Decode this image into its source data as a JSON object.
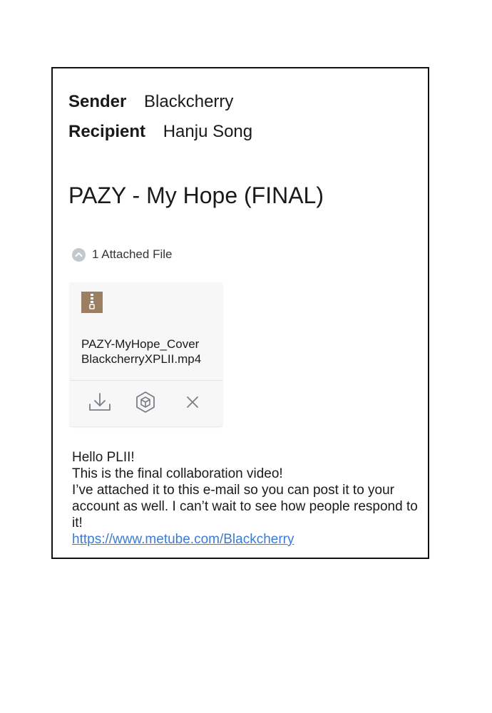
{
  "email": {
    "sender_label": "Sender",
    "sender_value": "Blackcherry",
    "recipient_label": "Recipient",
    "recipient_value": "Hanju Song",
    "subject": "PAZY - My Hope (FINAL)"
  },
  "attachments": {
    "count_label": "1 Attached File",
    "files": [
      {
        "name_line1": "PAZY-MyHope_Cover",
        "name_line2": "BlackcherryXPLII.mp4",
        "icon": "zip-file-icon"
      }
    ],
    "actions": [
      {
        "name": "download",
        "icon": "download-icon"
      },
      {
        "name": "archive",
        "icon": "cube-icon"
      },
      {
        "name": "remove",
        "icon": "close-icon"
      }
    ]
  },
  "body": {
    "lines": [
      "Hello PLII!",
      "This is the final collaboration video!",
      "I’ve attached it to this e-mail so you can post it to your account as well. I can’t wait to see how people respond to it!"
    ],
    "link": "https://www.metube.com/Blackcherry"
  },
  "colors": {
    "link": "#3b7bd4",
    "zip_icon": "#9a7f62",
    "icon_gray": "#7a7f86",
    "chevron_bg": "#c3c8cf"
  }
}
